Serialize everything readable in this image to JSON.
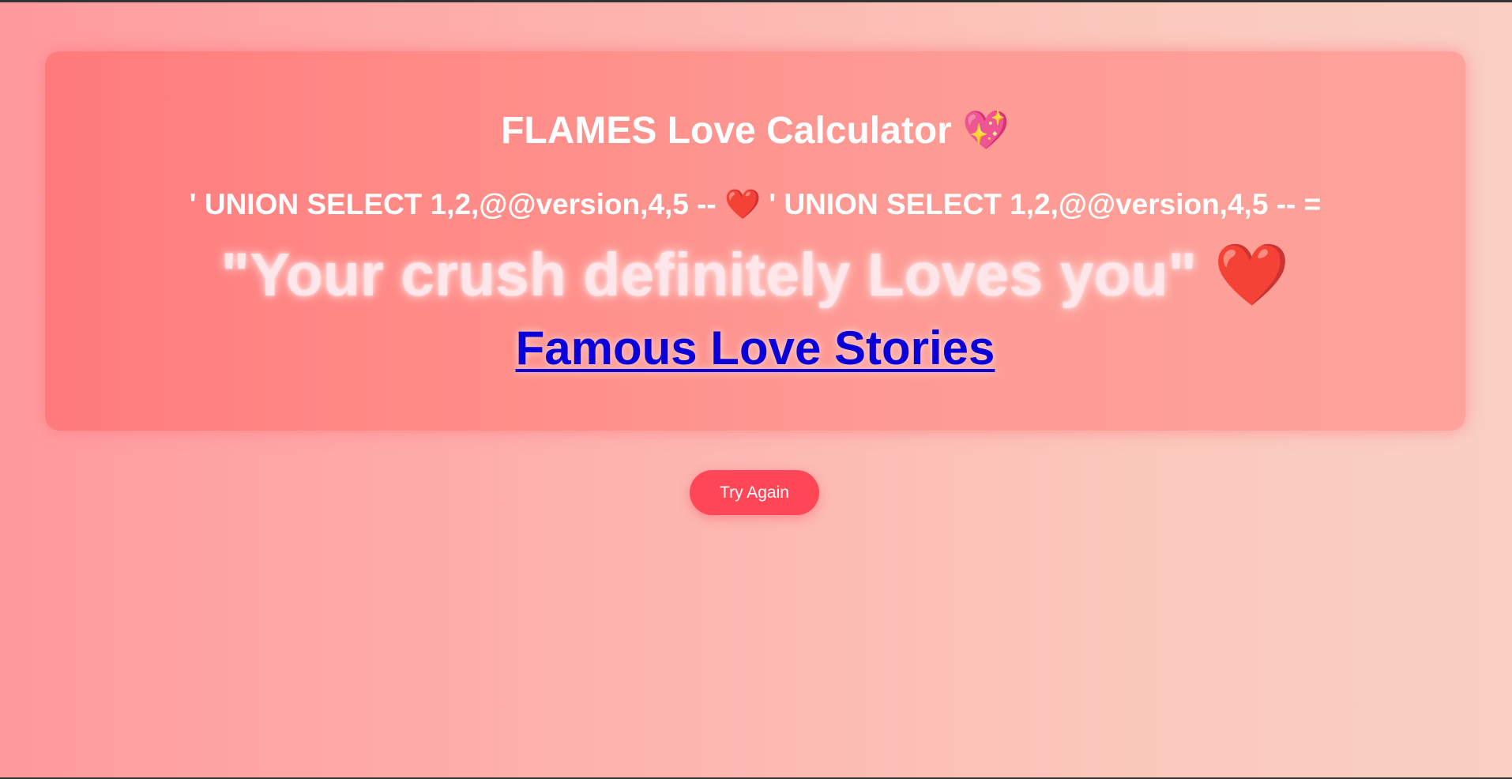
{
  "header": {
    "title": "FLAMES Love Calculator",
    "title_emoji": "💖"
  },
  "names": {
    "name1": "' UNION SELECT 1,2,@@version,4,5 --",
    "separator_emoji": "❤️",
    "name2": "' UNION SELECT 1,2,@@version,4,5 --",
    "equals": "="
  },
  "result": {
    "text": "\"Your crush definitely Loves you\"",
    "emoji": "❤️"
  },
  "links": {
    "famous_love_stories": "Famous Love Stories"
  },
  "actions": {
    "try_again_label": "Try Again"
  },
  "colors": {
    "background_start": "#ff9a9e",
    "background_end": "#fad0c4",
    "card_accent": "#ff7a7d",
    "button": "#ff4757",
    "link": "#0a00d8"
  }
}
